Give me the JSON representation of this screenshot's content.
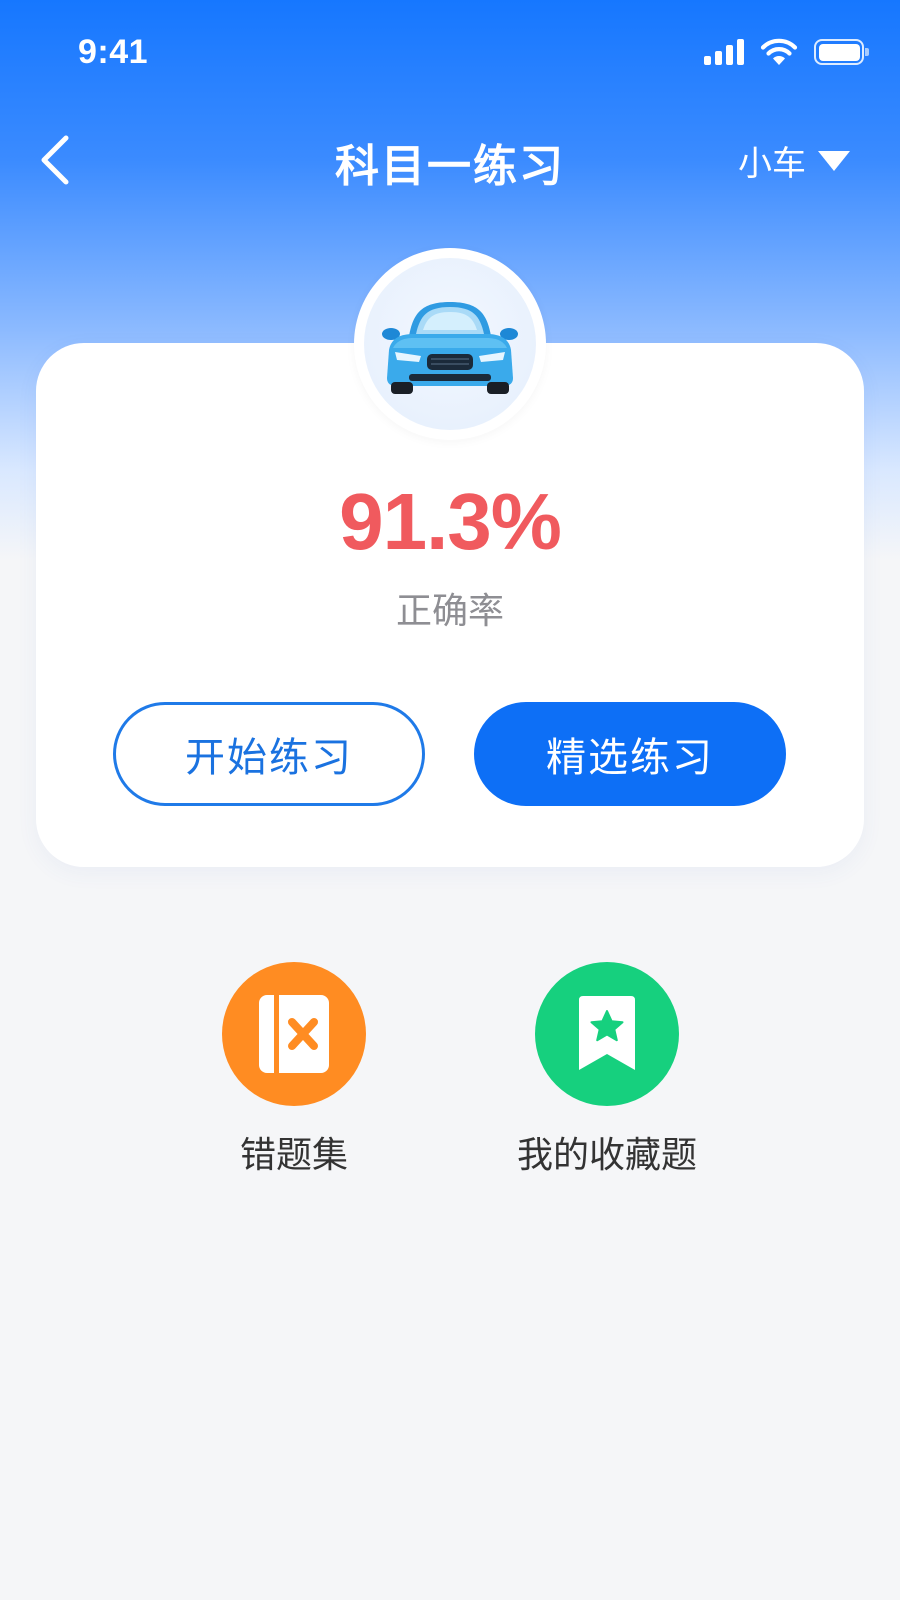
{
  "status_bar": {
    "time": "9:41"
  },
  "nav": {
    "title": "科目一练习",
    "vehicle_type": "小车"
  },
  "card": {
    "accuracy": "91.3%",
    "accuracy_label": "正确率",
    "start_button": "开始练习",
    "selected_button": "精选练习"
  },
  "shortcuts": [
    {
      "label": "错题集",
      "icon": "wrong-questions-icon",
      "color": "#ff8c22"
    },
    {
      "label": "我的收藏题",
      "icon": "favorite-questions-icon",
      "color": "#16d07e"
    }
  ],
  "colors": {
    "primary": "#0d6ff6",
    "accuracy": "#f05a5e"
  }
}
